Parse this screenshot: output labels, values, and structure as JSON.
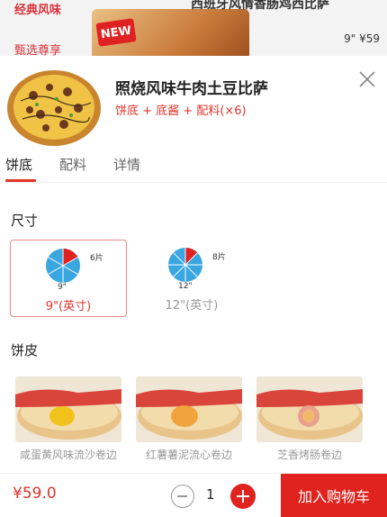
{
  "background": {
    "category_1": "经典风味",
    "category_2": "甄选尊享",
    "badge": "NEW",
    "item_title": "西班牙风情香肠鸡西比萨",
    "item_price": "9\" ¥59"
  },
  "product": {
    "title": "照烧风味牛肉土豆比萨",
    "subtitle": "饼底 + 底酱 + 配料(×6)"
  },
  "tabs": [
    {
      "label": "饼底",
      "active": true
    },
    {
      "label": "配料",
      "active": false
    },
    {
      "label": "详情",
      "active": false
    }
  ],
  "size_section": {
    "title": "尺寸",
    "options": [
      {
        "slices": "6片",
        "inch": "9\"",
        "label": "9\"(英寸)",
        "selected": true
      },
      {
        "slices": "8片",
        "inch": "12\"",
        "label": "12\"(英寸)",
        "selected": false
      }
    ]
  },
  "crust_section": {
    "title": "饼皮",
    "items": [
      {
        "name": "咸蛋黄风味流沙卷边",
        "filling_color": "#f2c21c"
      },
      {
        "name": "红薯薯泥流心卷边",
        "filling_color": "#f0a33a"
      },
      {
        "name": "芝香烤肠卷边",
        "filling_color": "#e8a090"
      }
    ]
  },
  "cart": {
    "price": "¥59.0",
    "quantity": "1",
    "add_label": "加入购物车"
  },
  "colors": {
    "accent": "#e0231f",
    "pie_blue": "#3aa6e0",
    "pie_red": "#e02121"
  }
}
